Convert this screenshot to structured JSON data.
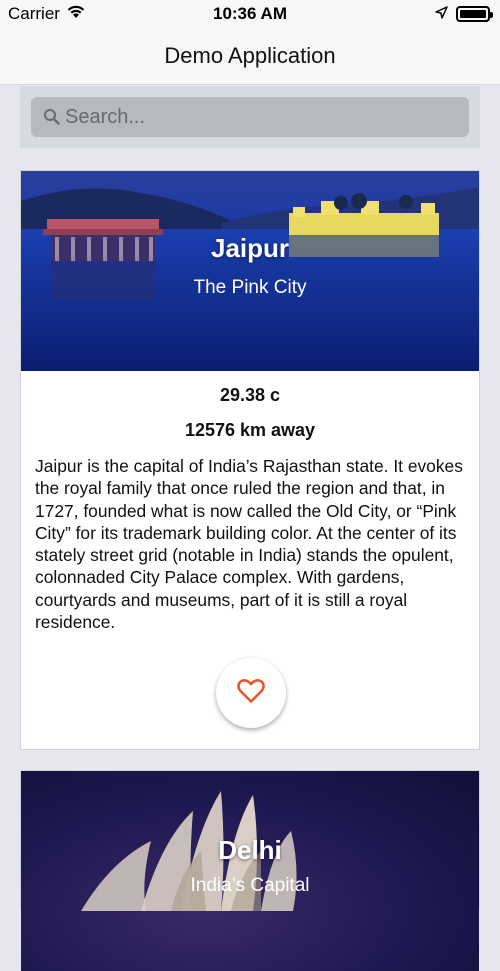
{
  "status_bar": {
    "carrier": "Carrier",
    "time": "10:36 AM",
    "icons": [
      "wifi-icon",
      "location-arrow-icon",
      "battery-icon"
    ]
  },
  "nav": {
    "title": "Demo Application"
  },
  "search": {
    "placeholder": "Search...",
    "value": ""
  },
  "cities": [
    {
      "name": "Jaipur",
      "tagline": "The Pink City",
      "temperature": "29.38 c",
      "distance": "12576 km away",
      "description": "Jaipur is the capital of India’s Rajasthan state. It evokes the royal family that once ruled the region and that, in 1727, founded what is now called the Old City, or “Pink City” for its trademark building color. At the center of its stately street grid (notable in India) stands the opulent, colonnaded City Palace complex. With gardens, courtyards and museums, part of it is still a royal residence.",
      "favorite_icon": "heart-outline-icon",
      "favorite_color": "#e8562a"
    },
    {
      "name": "Delhi",
      "tagline": "India’s Capital"
    }
  ],
  "colors": {
    "accent": "#e8562a",
    "background": "#e6e6ee",
    "search_box": "#b4bac0"
  }
}
